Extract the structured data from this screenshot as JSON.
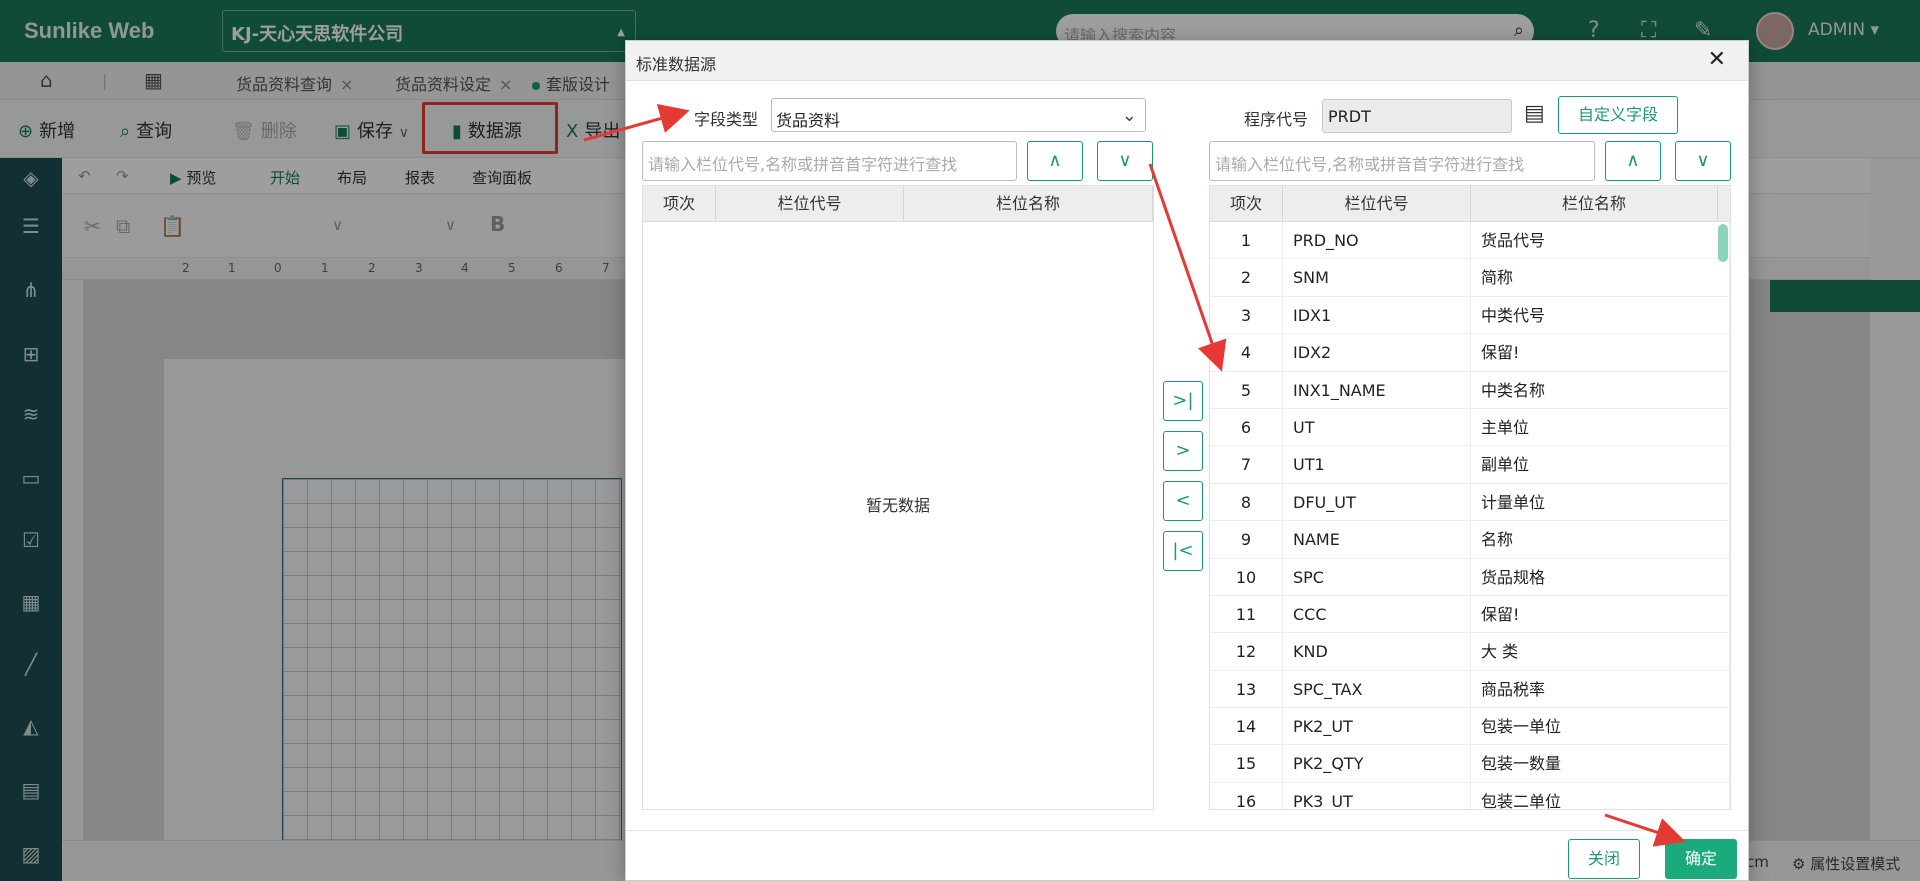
{
  "app": {
    "brand": "Sunlike Web",
    "company": "KJ-天心天思软件公司",
    "search_placeholder": "请输入搜索内容",
    "user": "ADMIN"
  },
  "tabs": [
    {
      "label": "货品资料查询"
    },
    {
      "label": "货品资料设定"
    },
    {
      "label": "套版设计"
    }
  ],
  "toolbar": {
    "new": "新增",
    "query": "查询",
    "delete": "删除",
    "save": "保存",
    "datasource": "数据源",
    "export": "导出"
  },
  "editor": {
    "preview": "预览",
    "tabs": [
      "开始",
      "布局",
      "报表",
      "查询面板"
    ],
    "ruler": [
      "2",
      "1",
      "0",
      "1",
      "2",
      "3",
      "4",
      "5",
      "6",
      "7"
    ],
    "status_unit": "cm",
    "status_mode": "属性设置模式"
  },
  "dialog": {
    "title": "标准数据源",
    "field_type_label": "字段类型",
    "field_type_value": "货品资料",
    "program_code_label": "程序代号",
    "program_code_value": "PRDT",
    "custom_field_button": "自定义字段",
    "left_search_placeholder": "请输入栏位代号,名称或拼音首字符进行查找",
    "right_search_placeholder": "请输入栏位代号,名称或拼音首字符进行查找",
    "columns": [
      "项次",
      "栏位代号",
      "栏位名称"
    ],
    "empty_text": "暂无数据",
    "rows": [
      {
        "no": "1",
        "code": "PRD_NO",
        "name": "货品代号"
      },
      {
        "no": "2",
        "code": "SNM",
        "name": "简称"
      },
      {
        "no": "3",
        "code": "IDX1",
        "name": "中类代号"
      },
      {
        "no": "4",
        "code": "IDX2",
        "name": "保留!"
      },
      {
        "no": "5",
        "code": "INX1_NAME",
        "name": "中类名称"
      },
      {
        "no": "6",
        "code": "UT",
        "name": "主单位"
      },
      {
        "no": "7",
        "code": "UT1",
        "name": "副单位"
      },
      {
        "no": "8",
        "code": "DFU_UT",
        "name": "计量单位"
      },
      {
        "no": "9",
        "code": "NAME",
        "name": "名称"
      },
      {
        "no": "10",
        "code": "SPC",
        "name": "货品规格"
      },
      {
        "no": "11",
        "code": "CCC",
        "name": "保留!"
      },
      {
        "no": "12",
        "code": "KND",
        "name": "大 类"
      },
      {
        "no": "13",
        "code": "SPC_TAX",
        "name": "商品税率"
      },
      {
        "no": "14",
        "code": "PK2_UT",
        "name": "包装一单位"
      },
      {
        "no": "15",
        "code": "PK2_QTY",
        "name": "包装一数量"
      },
      {
        "no": "16",
        "code": "PK3_UT",
        "name": "包装二单位"
      }
    ],
    "close_button": "关闭",
    "ok_button": "确定"
  }
}
